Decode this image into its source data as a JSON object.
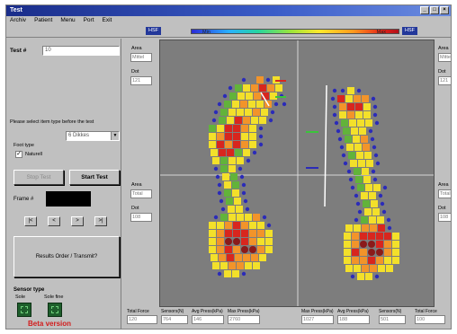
{
  "window": {
    "title": "Test"
  },
  "menu": [
    "Archiv",
    "Patient",
    "Menu",
    "Port",
    "Exit"
  ],
  "toolbar": {
    "scale_left": "HSF",
    "scale_right": "HSF",
    "colorbar_min": "Min",
    "colorbar_max": "Max"
  },
  "left_panel": {
    "test_label": "Test #",
    "test_value": "10",
    "instruction": "Please select item type before the test",
    "select_value": "6 Dikkes",
    "foot_type_label": "Foot type",
    "checkbox_label": "Naturell",
    "start_button": "Start Test",
    "stop_button": "Stop Test",
    "frame_label": "Frame #",
    "nav_buttons": [
      "|<",
      "<",
      ">",
      ">|"
    ],
    "results_button": "Results Order / Transmit?",
    "sensor_type_label": "Sensor type",
    "sensor_left_label": "Sole",
    "sensor_right_label": "Sole fine",
    "beta_text": "Beta version"
  },
  "side_left": {
    "area_label": "Area",
    "area_value": "Mittel",
    "dot_label": "Dot",
    "dot_value": "121",
    "area2_label": "Area",
    "area2_value": "Total",
    "dot2_label": "Dot",
    "dot2_value": "108"
  },
  "side_right": {
    "area_label": "Area",
    "area_value": "Mittel",
    "dot_label": "Dot",
    "dot_value": "121",
    "area2_label": "Area",
    "area2_value": "Total",
    "dot2_label": "Dot",
    "dot2_value": "108"
  },
  "bottom": [
    {
      "label": "Total Force",
      "value": "120"
    },
    {
      "label": "Sensors(N)",
      "value": "764"
    },
    {
      "label": "Avg Press(kPa)",
      "value": "146"
    },
    {
      "label": "Max Press(kPa)",
      "value": "2760"
    },
    {
      "label": "Max Press(kPa)",
      "value": "1027"
    },
    {
      "label": "Avg Press(kPa)",
      "value": "188"
    },
    {
      "label": "Sensors(N)",
      "value": "501"
    },
    {
      "label": "Total Force",
      "value": "100"
    }
  ],
  "colors": {
    "plot_bg": "#7d7d7d",
    "sensor_dot": "#2b2bb8",
    "green": "#62b33a",
    "yellow": "#f3e02a",
    "orange": "#f2942a",
    "red": "#d8261e",
    "darkred": "#8b1a1a"
  }
}
